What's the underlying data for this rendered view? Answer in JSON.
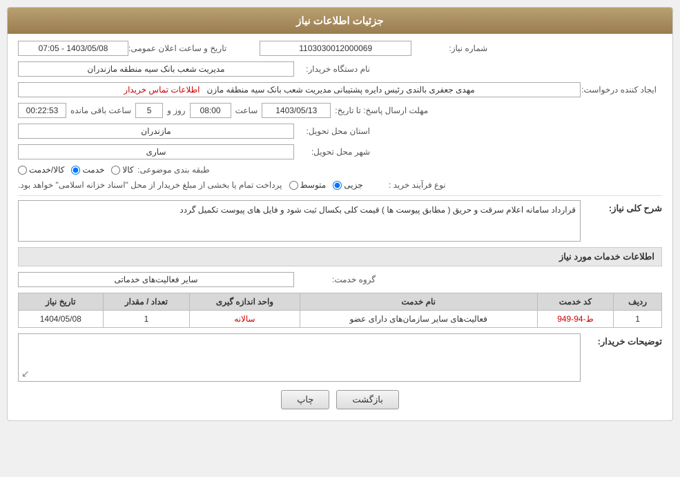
{
  "header": {
    "title": "جزئیات اطلاعات نیاز"
  },
  "fields": {
    "need_number_label": "شماره نیاز:",
    "need_number_value": "1103030012000069",
    "buyer_org_label": "نام دستگاه خریدار:",
    "buyer_org_value": "مدیریت شعب بانک سیه منطقه مازندران",
    "creator_label": "ایجاد کننده درخواست:",
    "creator_value": "مهدی جعفری بالندی رئیس دایره پشتیبانی مدیریت شعب بانک سیه منطقه مازن",
    "contact_link": "اطلاعات تماس خریدار",
    "announce_datetime_label": "تاریخ و ساعت اعلان عمومی:",
    "announce_datetime_value": "1403/05/08 - 07:05",
    "reply_deadline_label": "مهلت ارسال پاسخ: تا تاریخ:",
    "reply_date": "1403/05/13",
    "reply_time_label": "ساعت",
    "reply_time": "08:00",
    "reply_days_label": "روز و",
    "reply_days": "5",
    "remaining_label": "ساعت باقی مانده",
    "remaining_time": "00:22:53",
    "province_label": "استان محل تحویل:",
    "province_value": "مازندران",
    "city_label": "شهر محل تحویل:",
    "city_value": "ساری",
    "category_label": "طبقه بندی موضوعی:",
    "category_radio_goods": "کالا",
    "category_radio_service": "خدمت",
    "category_radio_goods_service": "کالا/خدمت",
    "process_label": "نوع فرآیند خرید :",
    "process_radio_part": "جزیی",
    "process_radio_medium": "متوسط",
    "process_text": "پرداخت تمام یا بخشی از مبلغ خریدار از محل \"اسناد خزانه اسلامی\" خواهد بود.",
    "need_description_label": "شرح کلی نیاز:",
    "need_description_value": "قرارداد سامانه اعلام سرقت و حریق  ( مطابق پیوست ها ) قیمت کلی بکسال ثبت شود  و فایل های پیوست تکمیل گردد",
    "services_info_label": "اطلاعات خدمات مورد نیاز",
    "service_group_label": "گروه خدمت:",
    "service_group_value": "سایر فعالیت‌های خدماتی",
    "table": {
      "columns": [
        "ردیف",
        "کد خدمت",
        "نام خدمت",
        "واحد اندازه گیری",
        "تعداد / مقدار",
        "تاریخ نیاز"
      ],
      "rows": [
        {
          "row": "1",
          "code": "ط-94-949",
          "name": "فعالیت‌های سایر سازمان‌های دارای عضو",
          "unit": "سالانه",
          "qty": "1",
          "date": "1404/05/08"
        }
      ]
    },
    "buyer_notes_label": "توضیحات خریدار:",
    "buyer_notes_value": ""
  },
  "buttons": {
    "back_label": "بازگشت",
    "print_label": "چاپ"
  }
}
